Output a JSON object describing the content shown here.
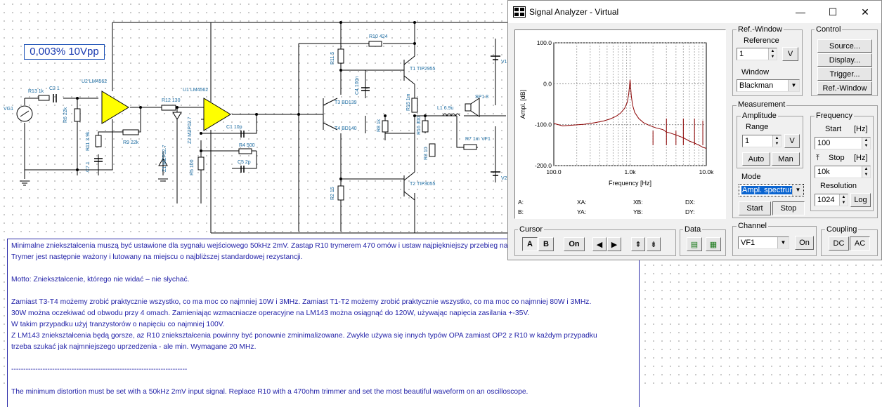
{
  "schematic": {
    "distortion_readout": "0,003% 10Vpp",
    "labels": {
      "vg1": "VG1",
      "r13": "R13 1k",
      "c2": "C2 1",
      "u2": "U2 LM4562",
      "r6": "R6 22k",
      "r11": "R11 3.9k",
      "c7": "C7 1",
      "r9": "R9 22k",
      "r12": "R12 130",
      "u1": "U1 LM4562",
      "z2": "Z2 MZP02.7",
      "z1": "Z1 MZP02.7",
      "r5": "R5 100",
      "c1": "C1 10p",
      "r4": "R4 500",
      "c5": "C5 2p",
      "r11b": "R11 5",
      "r10": "R10 424",
      "c4": "C4 100n",
      "t3": "T3 BD139",
      "t4": "T4 BD140",
      "t1": "T1 TIP2955",
      "r15": "R15 1m",
      "r8": "R8 1k",
      "r16": "R16 300",
      "r3": "R3 10",
      "r2": "R2 15",
      "t2": "T2 TIP3055",
      "l1": "L1 6.9u",
      "sp1": "SP1 8",
      "r7": "R7 1m",
      "vf1": "VF1",
      "v1": "V1",
      "v2": "V2"
    }
  },
  "note": {
    "lines": [
      "Minimalne zniekształcenia muszą być ustawione dla sygnału wejściowego 50kHz 2mV. Zastąp R10 trymerem 470 omów i ustaw najpiękniejszy przebieg na oscyloskopie.",
      "Trymer jest następnie ważony i lutowany na miejscu o najbliższej standardowej rezystancji.",
      "",
      "Motto: Zniekształcenie, którego nie widać – nie słychać.",
      "",
      "Zamiast T3-T4 możemy zrobić praktycznie wszystko, co ma moc co najmniej 10W i 3MHz. Zamiast T1-T2 możemy zrobić praktycznie wszystko, co ma moc co najmniej 80W i 3MHz.",
      "30W można oczekiwać od obwodu przy 4 omach. Zamieniając wzmacniacze operacyjne na LM143 można osiągnąć do 120W, używając napięcia zasilania +-35V.",
      "W takim przypadku użyj tranzystorów o napięciu co najmniej 100V.",
      "Z LM143 zniekształcenia będą gorsze, az R10 zniekształcenia powinny być ponownie zminimalizowane. Zwykle używa się innych typów OPA zamiast OP2 z R10 w każdym przypadku",
      "trzeba szukać jak najmniejszego uprzedzenia - ale min. Wymagane 20 MHz.",
      "",
      "-------------------------------------------------------------------------",
      "",
      "The minimum distortion must be set with a 50kHz 2mV input signal. Replace R10 with a 470ohm trimmer and set the most beautiful waveform on an oscilloscope."
    ]
  },
  "analyzer": {
    "title": "Signal Analyzer - Virtual",
    "window_buttons": {
      "minimize": "—",
      "maximize": "☐",
      "close": "✕"
    },
    "ref_window": {
      "title": "Ref.-Window",
      "reference_label": "Reference",
      "reference_value": "1",
      "reference_unit": "V",
      "window_label": "Window",
      "window_value": "Blackman"
    },
    "control": {
      "title": "Control",
      "buttons": [
        "Source...",
        "Display...",
        "Trigger...",
        "Ref.-Window"
      ]
    },
    "measurement": {
      "title": "Measurement"
    },
    "amplitude": {
      "title": "Amplitude",
      "range_label": "Range",
      "range_value": "1",
      "range_unit": "V",
      "auto": "Auto",
      "man": "Man"
    },
    "frequency": {
      "title": "Frequency",
      "start_label": "Start",
      "start_unit": "[Hz]",
      "start_value": "100",
      "stop_label": "Stop",
      "stop_unit": "[Hz]",
      "stop_value": "10k",
      "resolution_label": "Resolution",
      "resolution_value": "1024",
      "log": "Log"
    },
    "mode": {
      "title": "Mode",
      "value": "Ampl. spectrum",
      "start": "Start",
      "stop": "Stop"
    },
    "cursor": {
      "title": "Cursor",
      "a": "A",
      "b": "B",
      "on": "On"
    },
    "data": {
      "title": "Data"
    },
    "channel": {
      "title": "Channel",
      "value": "VF1",
      "on": "On"
    },
    "coupling": {
      "title": "Coupling",
      "dc": "DC",
      "ac": "AC"
    },
    "readouts": {
      "a": "A:",
      "b": "B:",
      "xa": "XA:",
      "ya": "YA:",
      "xb": "XB:",
      "yb": "YB:",
      "dx": "DX:",
      "dy": "DY:"
    }
  },
  "chart_data": {
    "type": "line",
    "title": "",
    "xlabel": "Frequency [Hz]",
    "ylabel": "Ampl. [dB]",
    "x_scale": "log",
    "xlim": [
      100,
      10000
    ],
    "ylim": [
      -200,
      100
    ],
    "x_tick_labels": [
      "100.0",
      "1.0k",
      "10.0k"
    ],
    "y_tick_labels": [
      "100.0",
      "0.0",
      "-100.0",
      "-200.0"
    ],
    "y_ticks": [
      100,
      0,
      -100,
      -200
    ],
    "grid": true,
    "line_color": "#8b0000",
    "series": [
      {
        "x": [
          100,
          130,
          180,
          250,
          350,
          450,
          550,
          650,
          750,
          850,
          920,
          960,
          985,
          1000,
          1015,
          1040,
          1080,
          1150,
          1300,
          1500,
          1800,
          2200,
          2700,
          3000,
          3300,
          4000,
          5000,
          6000,
          7000,
          8000,
          9000,
          10000
        ],
        "y": [
          -97,
          -103,
          -101,
          -99,
          -95,
          -91,
          -86,
          -80,
          -72,
          -60,
          -45,
          -25,
          -5,
          10,
          -5,
          -30,
          -52,
          -70,
          -85,
          -95,
          -102,
          -108,
          -112,
          -118,
          -120,
          -125,
          -132,
          -140,
          -145,
          -150,
          -155,
          -158
        ]
      }
    ],
    "harmonics": [
      {
        "x": 2000,
        "y": -115
      },
      {
        "x": 3000,
        "y": -85
      },
      {
        "x": 4000,
        "y": -115
      },
      {
        "x": 5000,
        "y": -85
      },
      {
        "x": 7000,
        "y": -85
      },
      {
        "x": 9000,
        "y": -90
      }
    ]
  }
}
